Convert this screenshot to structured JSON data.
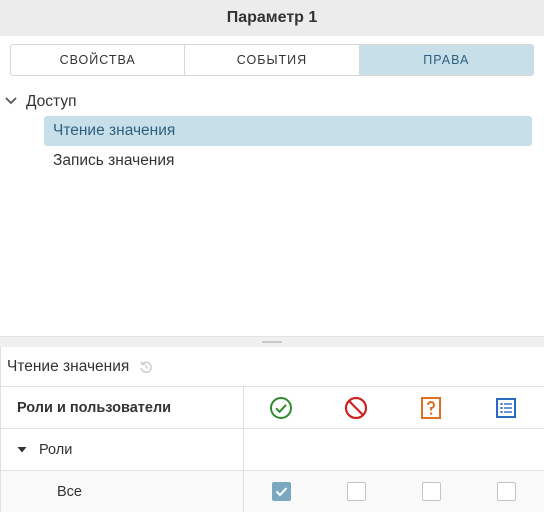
{
  "window": {
    "title": "Параметр 1"
  },
  "tabs": [
    {
      "label": "СВОЙСТВА",
      "active": false
    },
    {
      "label": "СОБЫТИЯ",
      "active": false
    },
    {
      "label": "ПРАВА",
      "active": true
    }
  ],
  "tree": {
    "root_label": "Доступ",
    "items": [
      {
        "label": "Чтение значения",
        "selected": true
      },
      {
        "label": "Запись значения",
        "selected": false
      }
    ]
  },
  "permissions": {
    "title": "Чтение значения",
    "column_header": "Роли и пользователи",
    "columns": [
      {
        "icon": "allow-circle-check-icon",
        "color": "#2e8b2e"
      },
      {
        "icon": "deny-circle-slash-icon",
        "color": "#cc2222"
      },
      {
        "icon": "question-square-icon",
        "color": "#e07020"
      },
      {
        "icon": "list-square-icon",
        "color": "#2a6bbf"
      }
    ],
    "group": {
      "label": "Роли"
    },
    "rows": [
      {
        "label": "Все",
        "values": [
          true,
          false,
          false,
          false
        ]
      }
    ]
  },
  "colors": {
    "accent_bg": "#c6dfe9",
    "accent_text": "#2f5f7e"
  }
}
